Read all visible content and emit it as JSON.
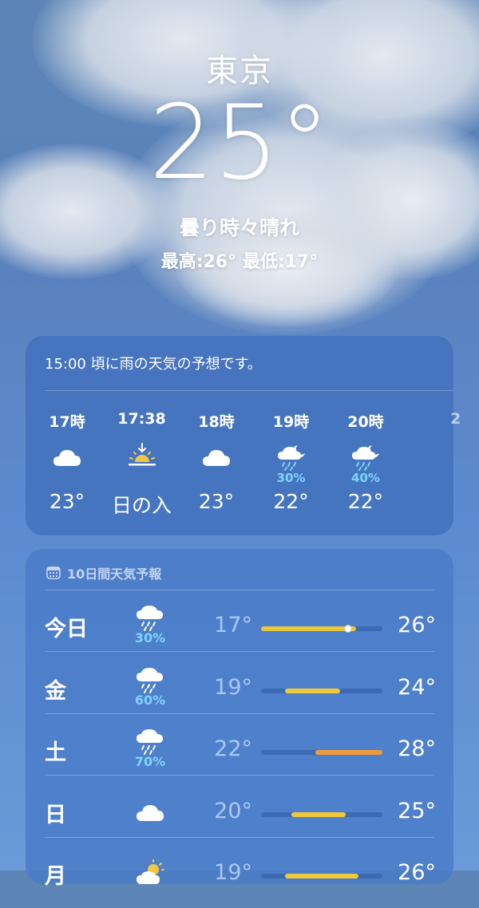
{
  "header": {
    "city": "東京",
    "temperature": "25°",
    "condition": "曇り時々晴れ",
    "high_low": "最高:26°  最低:17°"
  },
  "hourly": {
    "summary": "15:00 頃に雨の天気の予想です。",
    "items": [
      {
        "time": "17時",
        "icon": "cloud-icon",
        "precip": "",
        "value": "23°"
      },
      {
        "time": "17:38",
        "icon": "sunset-icon",
        "precip": "",
        "value": "日の入"
      },
      {
        "time": "18時",
        "icon": "cloud-icon",
        "precip": "",
        "value": "23°"
      },
      {
        "time": "19時",
        "icon": "cloud-moon-rain-icon",
        "precip": "30%",
        "value": "22°"
      },
      {
        "time": "20時",
        "icon": "cloud-moon-rain-icon",
        "precip": "40%",
        "value": "22°"
      }
    ]
  },
  "ten_day": {
    "title": "10日間天気予報",
    "title_icon": "calendar-icon",
    "days": [
      {
        "day": "今日",
        "icon": "cloud-rain-icon",
        "precip": "30%",
        "low": "17°",
        "high": "26°",
        "bar_start": 0.0,
        "bar_end": 0.78,
        "bar_color": "#e6c53a",
        "current_marker": 0.72
      },
      {
        "day": "金",
        "icon": "cloud-rain-icon",
        "precip": "60%",
        "low": "19°",
        "high": "24°",
        "bar_start": 0.2,
        "bar_end": 0.65,
        "bar_color": "#f0c83a"
      },
      {
        "day": "土",
        "icon": "cloud-rain-icon",
        "precip": "70%",
        "low": "22°",
        "high": "28°",
        "bar_start": 0.45,
        "bar_end": 1.0,
        "bar_color": "#f09a3a"
      },
      {
        "day": "日",
        "icon": "cloud-icon",
        "precip": "",
        "low": "20°",
        "high": "25°",
        "bar_start": 0.25,
        "bar_end": 0.7,
        "bar_color": "#f0c83a"
      },
      {
        "day": "月",
        "icon": "cloud-sun-icon",
        "precip": "",
        "low": "19°",
        "high": "26°",
        "bar_start": 0.2,
        "bar_end": 0.8,
        "bar_color": "#f0c83a"
      }
    ]
  },
  "colors": {
    "precip": "#7fd4ff",
    "sun": "#f5c542"
  }
}
